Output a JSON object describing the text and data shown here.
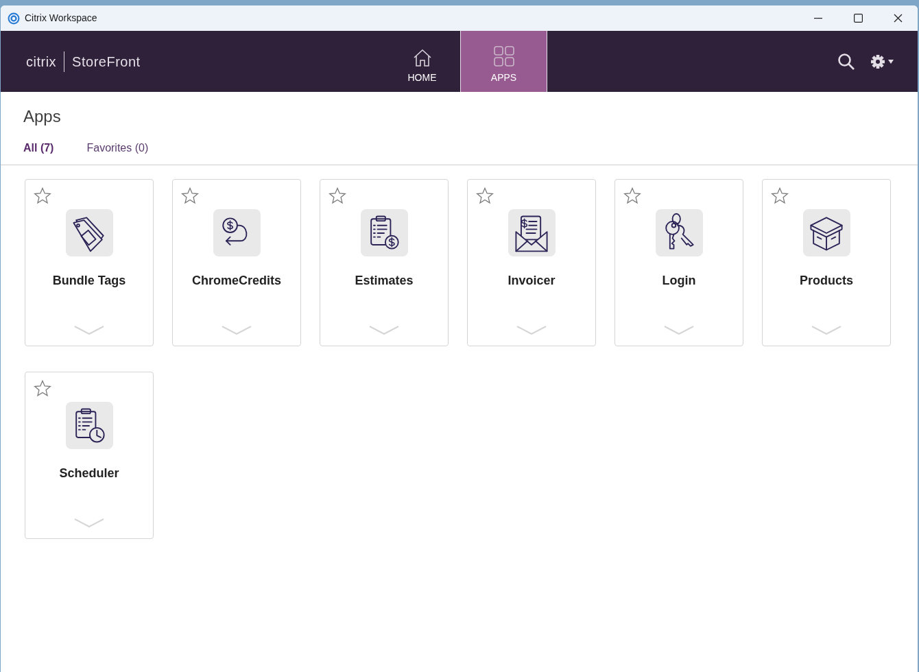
{
  "window": {
    "title": "Citrix Workspace"
  },
  "header": {
    "brand": "citrix",
    "product": "StoreFront",
    "nav": [
      {
        "label": "HOME",
        "kind": "home",
        "selected": false
      },
      {
        "label": "APPS",
        "kind": "apps",
        "selected": true
      }
    ]
  },
  "page": {
    "title": "Apps",
    "filters": [
      {
        "label": "All (7)",
        "selected": true
      },
      {
        "label": "Favorites (0)",
        "selected": false
      }
    ]
  },
  "apps": [
    {
      "name": "Bundle Tags",
      "kind": "tags",
      "favorite": false
    },
    {
      "name": "ChromeCredits",
      "kind": "credits",
      "favorite": false
    },
    {
      "name": "Estimates",
      "kind": "estimate",
      "favorite": false
    },
    {
      "name": "Invoicer",
      "kind": "invoice",
      "favorite": false
    },
    {
      "name": "Login",
      "kind": "keys",
      "favorite": false
    },
    {
      "name": "Products",
      "kind": "box",
      "favorite": false
    },
    {
      "name": "Scheduler",
      "kind": "schedule",
      "favorite": false
    }
  ]
}
